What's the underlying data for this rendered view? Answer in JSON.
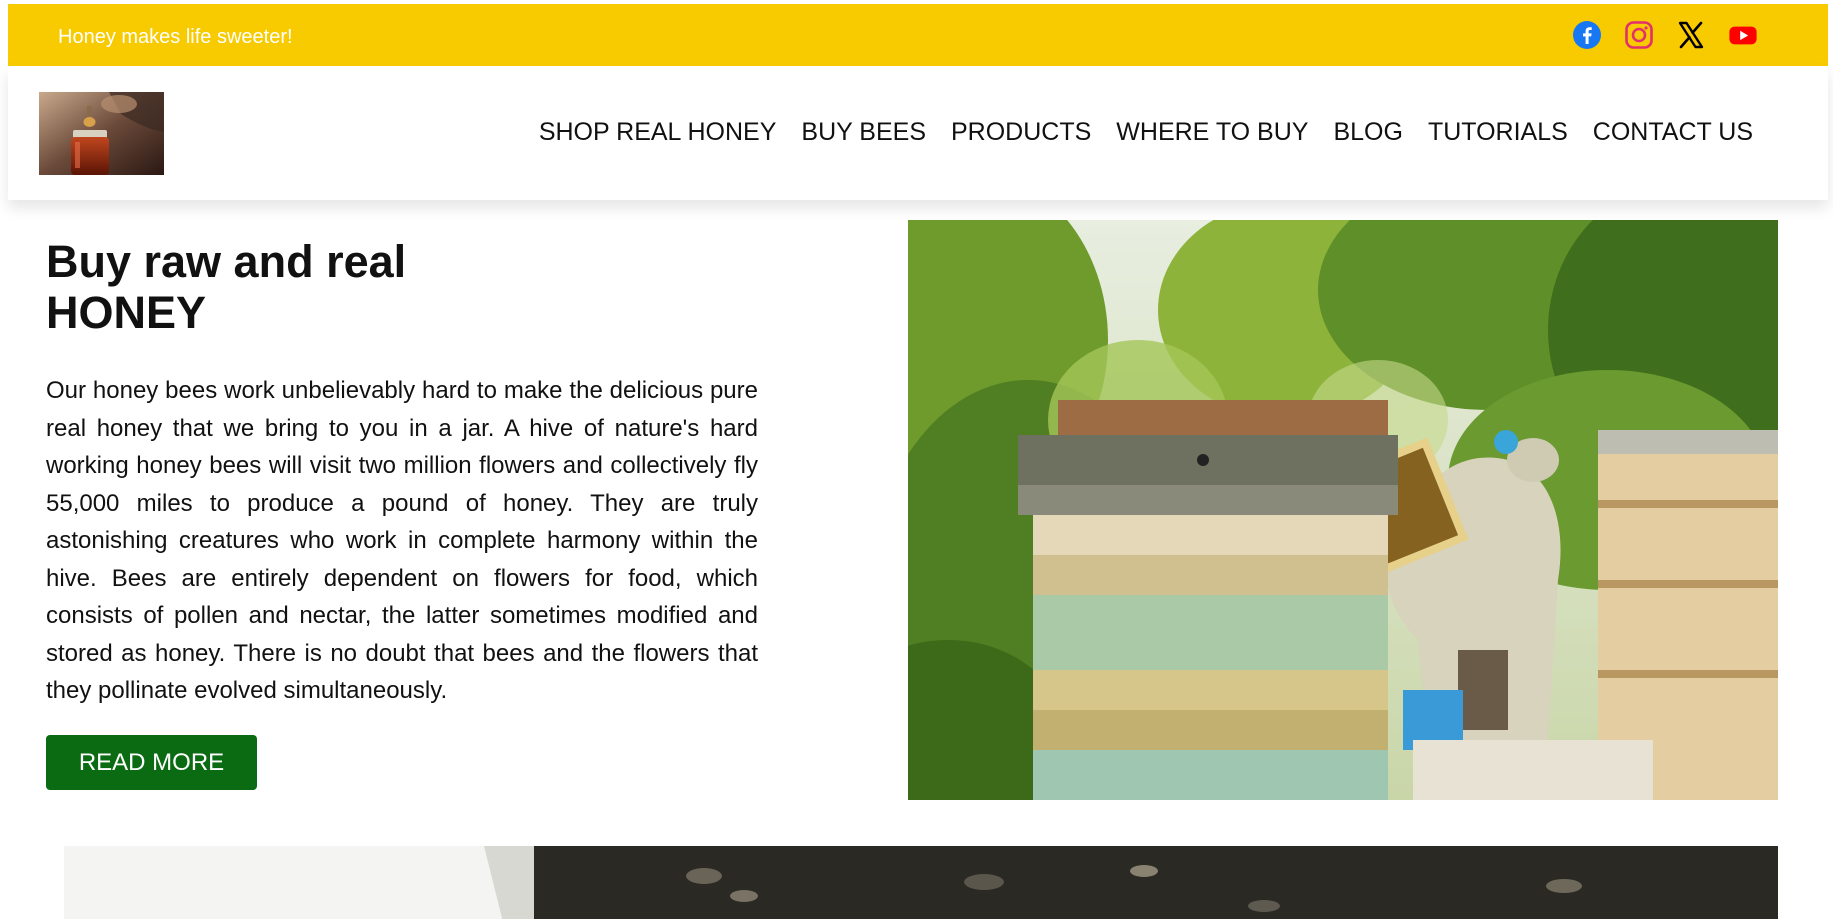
{
  "topbar": {
    "tagline": "Honey makes life sweeter!",
    "background_color": "#f8cb00",
    "socials": [
      {
        "name": "facebook-icon",
        "color": "#1877f2"
      },
      {
        "name": "instagram-icon",
        "color": "#e1306c"
      },
      {
        "name": "x-icon",
        "color": "#000000"
      },
      {
        "name": "youtube-icon",
        "color": "#ff0000"
      }
    ]
  },
  "header": {
    "logo_icon": "honey-jar-logo",
    "nav": [
      {
        "label": "SHOP REAL HONEY"
      },
      {
        "label": "BUY BEES"
      },
      {
        "label": "PRODUCTS"
      },
      {
        "label": "WHERE TO BUY"
      },
      {
        "label": "BLOG"
      },
      {
        "label": "TUTORIALS"
      },
      {
        "label": "CONTACT US"
      }
    ]
  },
  "hero": {
    "title_line1": "Buy raw and real",
    "title_line2": "HONEY",
    "body": "Our honey bees work unbelievably hard to make the delicious pure real honey that we bring to you in a jar. A hive of nature's hard working honey bees will visit two million flowers and collectively fly 55,000 miles to produce a pound of honey. They are truly astonishing creatures who work in complete harmony within the hive. Bees are entirely dependent on flowers for food, which consists of pollen and nectar, the latter sometimes modified and stored as honey. There is no doubt that bees and the flowers that they pollinate evolved simultaneously.",
    "button_label": "READ MORE",
    "button_color": "#0b6b12",
    "image": "beekeeper-with-hives-photo"
  },
  "banner": {
    "image": "bees-in-flight-photo"
  }
}
